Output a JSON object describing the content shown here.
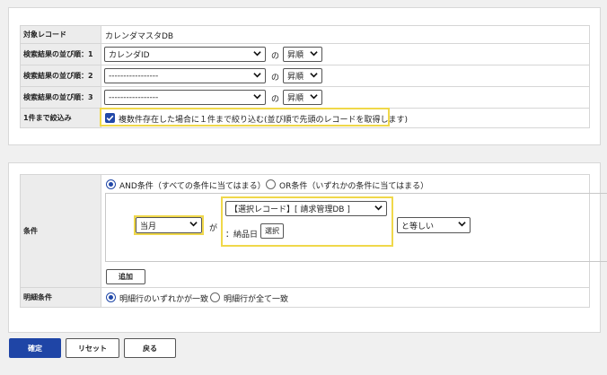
{
  "top": {
    "target_record_label": "対象レコード",
    "target_record_value": "カレンダマスタDB",
    "sort_rows": [
      {
        "label": "検索結果の並び順：1",
        "field": "カレンダID",
        "connector": "の",
        "order": "昇順"
      },
      {
        "label": "検索結果の並び順：2",
        "field": "-----------------",
        "connector": "の",
        "order": "昇順"
      },
      {
        "label": "検索結果の並び順：3",
        "field": "-----------------",
        "connector": "の",
        "order": "昇順"
      }
    ],
    "narrow_label": "1件まで絞込み",
    "narrow_checkbox_text": "複数件存在した場合に１件まで絞り込む(並び順で先頭のレコードを取得します)"
  },
  "cond": {
    "label": "条件",
    "and_option": "AND条件（すべての条件に当てはまる）",
    "or_option": "OR条件（いずれかの条件に当てはまる）",
    "value_select": "当月",
    "ga": "が",
    "record_select": "【選択レコード】[ 請求管理DB ]",
    "field_text": "：納品日",
    "select_button": "選択",
    "operator_select": "と等しい",
    "add_button": "追加"
  },
  "detail": {
    "label": "明細条件",
    "opt1": "明細行のいずれかが一致",
    "opt2": "明細行が全て一致"
  },
  "footer": {
    "confirm": "確定",
    "reset": "リセット",
    "back": "戻る"
  },
  "colors": {
    "accent": "#1f45a6",
    "highlight": "#f0d84a"
  }
}
